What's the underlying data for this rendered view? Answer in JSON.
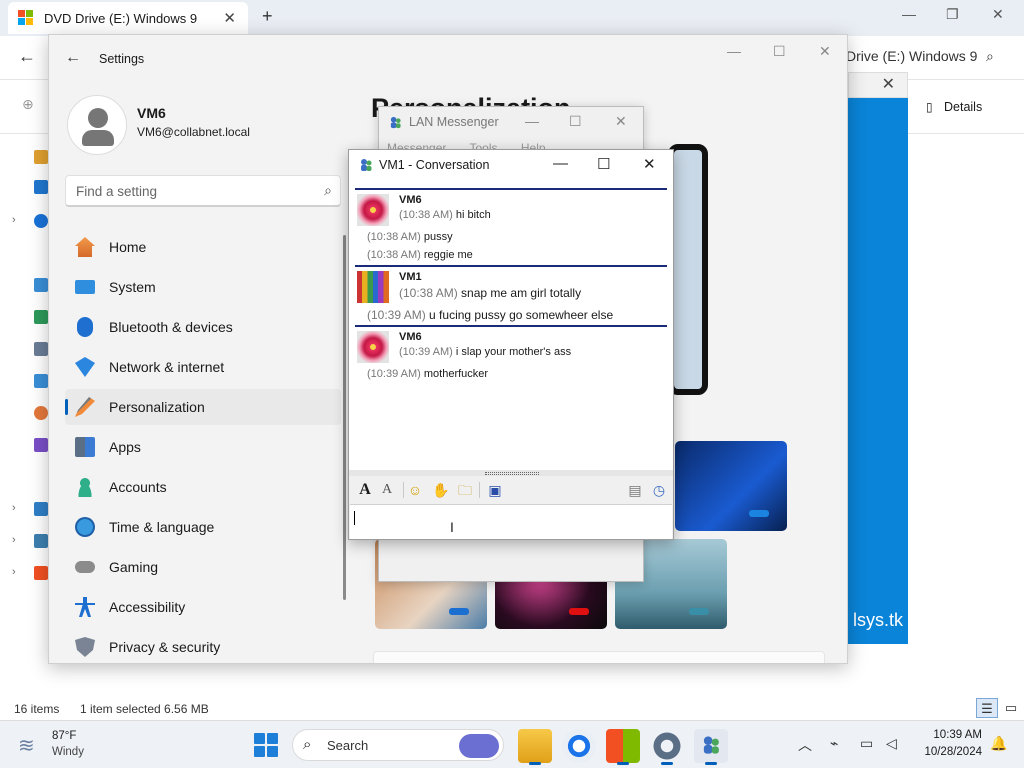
{
  "explorer": {
    "tab_title": "DVD Drive (E:) Windows 9",
    "tab_close": "✕",
    "new_tab": "+",
    "address_path": "Drive (E:) Windows 9",
    "details_label": "Details",
    "status_items": "16 items",
    "status_selected": "1 item selected  6.56 MB",
    "preview_text": "lsys.tk"
  },
  "settings": {
    "window_title": "Settings",
    "user_name": "VM6",
    "user_email": "VM6@collabnet.local",
    "search_placeholder": "Find a setting",
    "page_heading": "Personalization",
    "nav": [
      {
        "label": "Home",
        "icon": "home-icon"
      },
      {
        "label": "System",
        "icon": "system-icon"
      },
      {
        "label": "Bluetooth & devices",
        "icon": "bluetooth-icon"
      },
      {
        "label": "Network & internet",
        "icon": "wifi-icon"
      },
      {
        "label": "Personalization",
        "icon": "brush-icon",
        "active": true
      },
      {
        "label": "Apps",
        "icon": "apps-icon"
      },
      {
        "label": "Accounts",
        "icon": "accounts-icon"
      },
      {
        "label": "Time & language",
        "icon": "globe-clock-icon"
      },
      {
        "label": "Gaming",
        "icon": "gamepad-icon"
      },
      {
        "label": "Accessibility",
        "icon": "accessibility-icon"
      },
      {
        "label": "Privacy & security",
        "icon": "shield-icon"
      }
    ]
  },
  "lan_messenger": {
    "title": "LAN Messenger",
    "menu": [
      "Messenger",
      "Tools",
      "Help"
    ]
  },
  "conversation": {
    "title": "VM1 - Conversation",
    "blocks": [
      {
        "sender": "VM6",
        "avatar": "flower-avatar",
        "messages": [
          {
            "time": "(10:38 AM)",
            "text": "hi bitch"
          },
          {
            "time": "(10:38 AM)",
            "text": "pussy"
          },
          {
            "time": "(10:38 AM)",
            "text": "reggie me"
          }
        ]
      },
      {
        "sender": "VM1",
        "avatar": "crayons-avatar",
        "messages": [
          {
            "time": "(10:38 AM)",
            "text": "snap me am girl totally"
          },
          {
            "time": "(10:39 AM)",
            "text": "u fucing pussy go somewheer else"
          }
        ]
      },
      {
        "sender": "VM6",
        "avatar": "flower-avatar",
        "messages": [
          {
            "time": "(10:39 AM)",
            "text": "i slap your mother's ass"
          },
          {
            "time": "(10:39 AM)",
            "text": "motherfucker"
          }
        ]
      }
    ],
    "input_value": ""
  },
  "taskbar": {
    "weather_temp": "87°F",
    "weather_desc": "Windy",
    "search_placeholder": "Search",
    "time": "10:39 AM",
    "date": "10/28/2024"
  },
  "colors": {
    "accent": "#005fb8",
    "conversation_divider": "#1c2a7a",
    "preview_blue": "#0a84d8"
  }
}
